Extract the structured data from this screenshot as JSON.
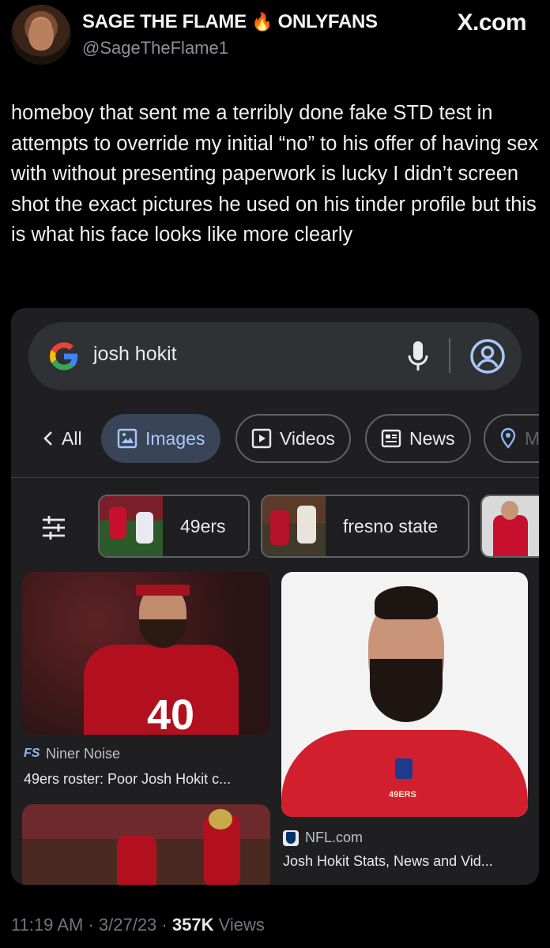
{
  "tweet": {
    "display_name": "SAGE THE FLAME",
    "name_emoji": "🔥",
    "name_suffix": "ONLYFANS",
    "handle": "@SageTheFlame1",
    "source_watermark": "X.com",
    "text": "homeboy that sent me a terribly done fake STD test in attempts to override my initial “no” to his offer of having sex with without presenting paperwork is lucky I didn’t screen shot the exact pictures he used on his tinder profile but this is what his face looks like more clearly",
    "time": "11:19 AM",
    "date": "3/27/23",
    "views_count": "357K",
    "views_label": "Views"
  },
  "search": {
    "query": "josh hokit",
    "tabs": [
      {
        "label": "All",
        "icon": "chevron-left-icon"
      },
      {
        "label": "Images",
        "icon": "image-icon",
        "active": true
      },
      {
        "label": "Videos",
        "icon": "play-icon"
      },
      {
        "label": "News",
        "icon": "newspaper-icon"
      },
      {
        "label": "M",
        "icon": "location-pin-icon"
      }
    ],
    "refinements": [
      {
        "label": "49ers"
      },
      {
        "label": "fresno state"
      },
      {
        "label": ""
      }
    ],
    "results": [
      {
        "source": "Niner Noise",
        "title": "49ers roster: Poor Josh Hokit c..."
      },
      {
        "source": "NFL.com",
        "title": "Josh Hokit Stats, News and Vid..."
      },
      {
        "source": "",
        "title": ""
      }
    ],
    "jersey_number": "40",
    "jersey_wordmark": "49ERS"
  },
  "colors": {
    "background": "#000000",
    "card": "#1f1f21",
    "accent_chip": "#394457",
    "accent_text": "#a8c7fa",
    "niners_red": "#c8102e"
  }
}
